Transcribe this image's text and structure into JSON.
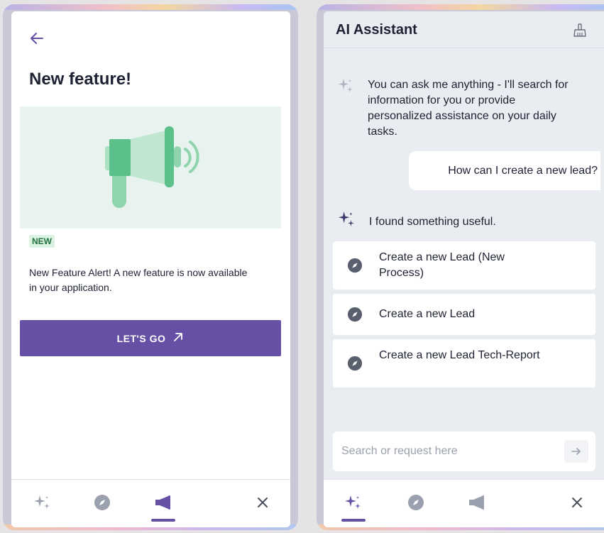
{
  "left_panel": {
    "title": "New feature!",
    "badge": "NEW",
    "description": "New Feature Alert! A new feature is now available in your application.",
    "cta_label": "LET'S GO",
    "active_nav": "announcements"
  },
  "right_panel": {
    "title": "AI Assistant",
    "messages": [
      {
        "role": "assistant",
        "text": "You can ask me anything - I'll search for information for you or provide personalized assistance on your daily tasks."
      },
      {
        "role": "user",
        "text": "How can I create a new lead?"
      },
      {
        "role": "assistant",
        "text": "I found something useful."
      }
    ],
    "results": [
      {
        "label": "Create a new Lead (New Process)"
      },
      {
        "label": "Create a new Lead"
      },
      {
        "label": "Create a new Lead Tech-Report"
      }
    ],
    "search": {
      "placeholder": "Search or request here",
      "value": ""
    },
    "active_nav": "ai-assistant"
  },
  "colors": {
    "accent": "#6550a6",
    "illustration_bg": "#e8f3ef",
    "badge_bg": "#d9f2e1",
    "badge_text": "#24733f",
    "megaphone_green": "#5cc08a"
  },
  "icons": [
    "back-arrow-icon",
    "megaphone-icon",
    "arrow-up-right-icon",
    "sparkles-icon",
    "compass-icon",
    "close-icon",
    "broom-icon",
    "send-arrow-icon"
  ]
}
